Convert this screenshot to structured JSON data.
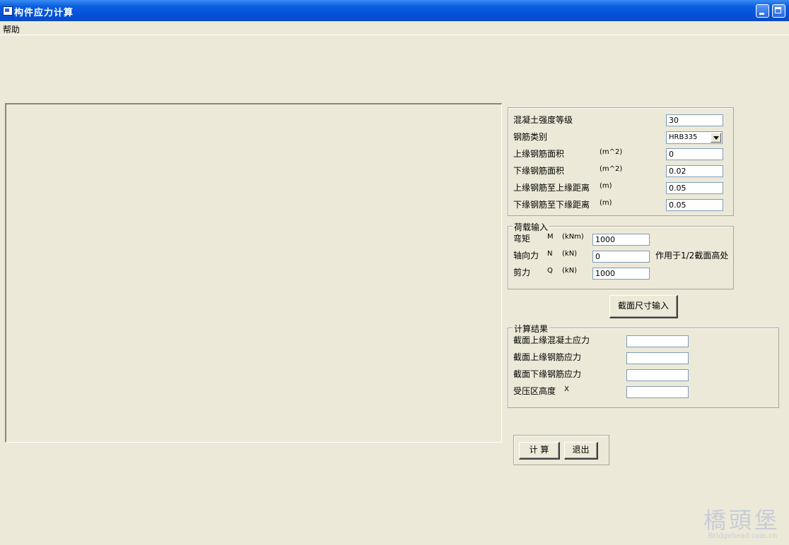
{
  "window": {
    "title": "构件应力计算"
  },
  "menu": {
    "help": "帮助"
  },
  "material": {
    "concrete_grade_label": "混凝土强度等级",
    "concrete_grade_value": "30",
    "rebar_type_label": "钢筋类别",
    "rebar_type_value": "HRB335",
    "top_rebar_area_label": "上缘钢筋面积",
    "top_rebar_area_unit": "(m^2)",
    "top_rebar_area_value": "0",
    "bottom_rebar_area_label": "下缘钢筋面积",
    "bottom_rebar_area_unit": "(m^2)",
    "bottom_rebar_area_value": "0.02",
    "top_rebar_dist_label": "上缘钢筋至上缘距离",
    "top_rebar_dist_unit": "(m)",
    "top_rebar_dist_value": "0.05",
    "bottom_rebar_dist_label": "下缘钢筋至下缘距离",
    "bottom_rebar_dist_unit": "(m)",
    "bottom_rebar_dist_value": "0.05"
  },
  "load": {
    "title": "荷载输入",
    "moment_label": "弯矩",
    "moment_symbol": "M",
    "moment_unit": "(kNm)",
    "moment_value": "1000",
    "axial_label": "轴向力",
    "axial_symbol": "N",
    "axial_unit": "(kN)",
    "axial_value": "0",
    "axial_note": "作用于1/2截面高处",
    "shear_label": "剪力",
    "shear_symbol": "Q",
    "shear_unit": "(kN)",
    "shear_value": "1000"
  },
  "section_button": "截面尺寸输入",
  "results": {
    "title": "计算结果",
    "top_concrete_stress_label": "截面上缘混凝土应力",
    "top_rebar_stress_label": "截面上缘钢筋应力",
    "bottom_rebar_stress_label": "截面下缘钢筋应力",
    "compression_height_label": "受压区高度",
    "compression_height_symbol": "X",
    "top_concrete_stress_value": "",
    "top_rebar_stress_value": "",
    "bottom_rebar_stress_value": "",
    "compression_height_value": ""
  },
  "actions": {
    "calculate": "计 算",
    "exit": "退出"
  },
  "watermark": {
    "main": "橋頭堡",
    "site": "Bridgehead.com.cn"
  }
}
